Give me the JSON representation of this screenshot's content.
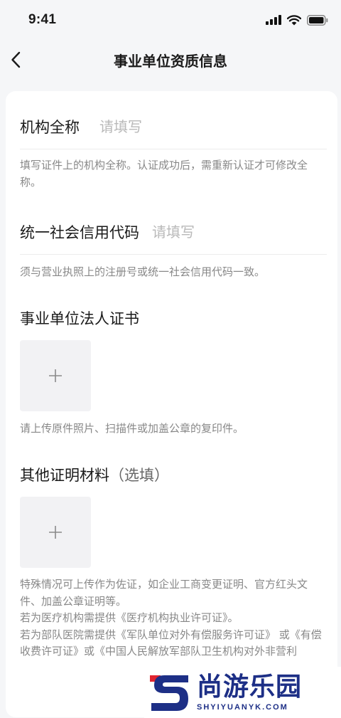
{
  "status_bar": {
    "time": "9:41"
  },
  "nav": {
    "title": "事业单位资质信息"
  },
  "form": {
    "org_name": {
      "label": "机构全称",
      "placeholder": "请填写",
      "hint": "填写证件上的机构全称。认证成功后，需重新认证才可修改全称。"
    },
    "credit_code": {
      "label": "统一社会信用代码",
      "placeholder": "请填写",
      "hint": "须与营业执照上的注册号或统一社会信用代码一致。"
    },
    "legal_cert": {
      "title": "事业单位法人证书",
      "hint": "请上传原件照片、扫描件或加盖公章的复印件。"
    },
    "other_docs": {
      "title": "其他证明材料",
      "optional": "（选填）",
      "notes": [
        "特殊情况可上传作为佐证，如企业工商变更证明、官方红头文件、加盖公章证明等。",
        "若为医疗机构需提供《医疗机构执业许可证》。",
        "若为部队医院需提供《军队单位对外有偿服务许可证》 或《有偿收费许可证》或《中国人民解放军部队卫生机构对外非营利"
      ]
    }
  },
  "watermark": {
    "text": "尚游乐园",
    "domain": "SHYIYUANYK.COM"
  },
  "colors": {
    "accent_red": "#e0242f",
    "watermark_blue": "#1d2f86"
  }
}
